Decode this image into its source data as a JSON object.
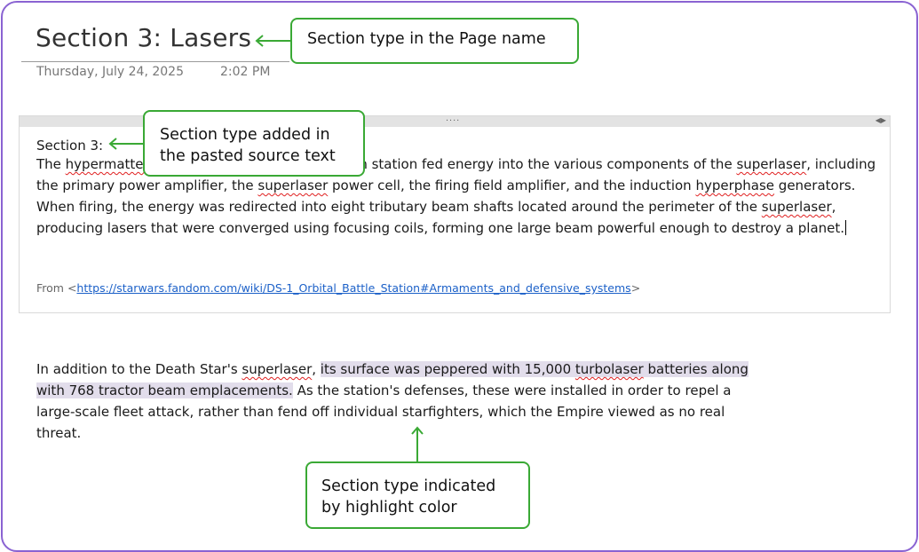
{
  "page": {
    "title": "Section 3: Lasers",
    "date": "Thursday, July 24, 2025",
    "time": "2:02 PM"
  },
  "callouts": {
    "page_name": "Section type in the Page name",
    "source_line1": "Section type added in",
    "source_line2": "the pasted source text",
    "highlight_line1": "Section type indicated",
    "highlight_line2": "by highlight color"
  },
  "container": {
    "grip": "....",
    "section_label": "Section 3:",
    "para1": [
      {
        "t": "The "
      },
      {
        "t": "hypermatter",
        "sq": true
      },
      {
        "t": " reactor in the Death Star's main station fed energy into the various components of the "
      },
      {
        "t": "superlaser",
        "sq": true
      },
      {
        "t": ", including the primary power amplifier, the "
      },
      {
        "t": "superlaser",
        "sq": true
      },
      {
        "t": " power cell, the firing field amplifier, and the induction "
      },
      {
        "t": "hyperphase",
        "sq": true
      },
      {
        "t": " generators. When firing, the energy was redirected into eight tributary beam shafts located around the perimeter of the "
      },
      {
        "t": "superlaser",
        "sq": true
      },
      {
        "t": ", producing lasers that were converged using focusing coils, forming one large beam powerful enough to destroy a planet."
      }
    ],
    "source_prefix": "From <",
    "source_url": "https://starwars.fandom.com/wiki/DS-1_Orbital_Battle_Station#Armaments_and_defensive_systems",
    "source_suffix": ">"
  },
  "para2": [
    {
      "t": "In addition to the Death Star's "
    },
    {
      "t": "superlaser",
      "sq": true
    },
    {
      "t": ", "
    },
    {
      "t": "its surface was peppered with 15,000 ",
      "hl": true
    },
    {
      "t": "turbolaser",
      "sq": true,
      "hl": true
    },
    {
      "t": " batteries along with 768 tractor beam emplacements.",
      "hl": true
    },
    {
      "t": " As the station's defenses, these were installed in order to repel a large-scale fleet attack, rather than fend off individual starfighters, which the Empire viewed as no real threat."
    }
  ],
  "colors": {
    "frame": "#8a63d2",
    "callout_border": "#3aa935",
    "highlight": "#e2ddeb",
    "link": "#1b60c8"
  }
}
